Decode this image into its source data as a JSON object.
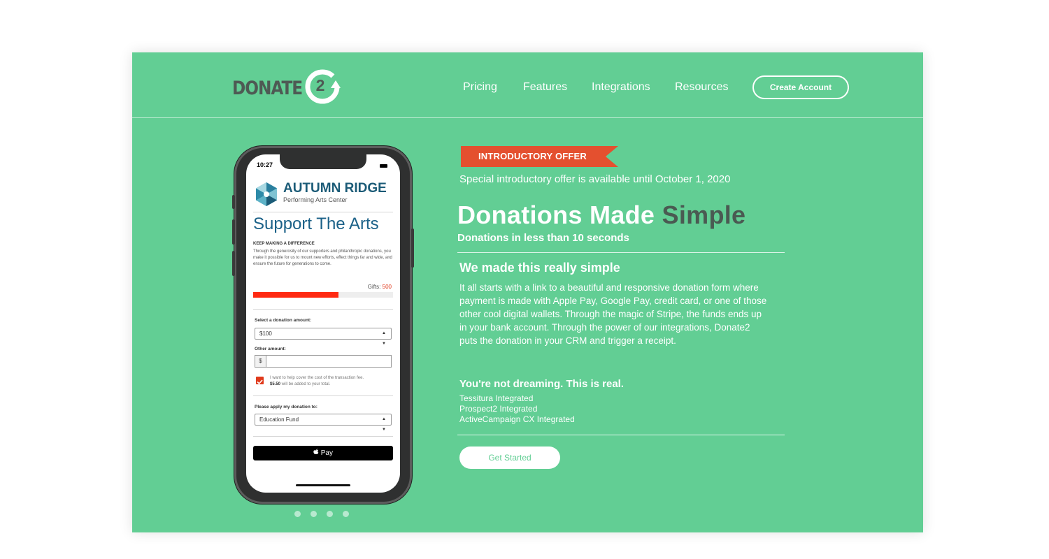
{
  "brand": {
    "logo_text": "DONATE",
    "logo_number": "2",
    "color_green": "#62ce94",
    "color_dark": "#4e5a54",
    "color_ribbon": "#e4502f"
  },
  "nav": {
    "links": [
      "Pricing",
      "Features",
      "Integrations",
      "Resources"
    ],
    "cta_label": "Create  Account"
  },
  "phone": {
    "time": "10:27",
    "org_name": "AUTUMN RIDGE",
    "org_sub": "Performing Arts Center",
    "heading": "Support The Arts",
    "kicker": "KEEP MAKING A DIFFERENCE",
    "body": "Through the generosity of our supporters and philanthropic donations, you make it possible for us to mount new efforts, effect things far and wide, and ensure the future for generations to come.",
    "gifts_label": "Gifts:",
    "gifts_count": "500",
    "progress_fraction": 0.61,
    "amount_label": "Select a donation amount:",
    "amount_value": "$100",
    "other_label": "Other amount:",
    "currency_symbol": "$",
    "fee_text": "I want to help cover the cost of the transaction fee.",
    "fee_amount": "$5.50",
    "fee_suffix": "will be added to your total.",
    "apply_label": "Please apply my donation to:",
    "apply_value": "Education Fund",
    "pay_label": "Pay",
    "pay_icon": "apple-icon"
  },
  "carousel": {
    "dot_count": 4
  },
  "hero": {
    "ribbon": "INTRODUCTORY OFFER",
    "special": "Special introductory offer is available until October 1, 2020",
    "headline_main": "Donations Made ",
    "headline_accent": "Simple",
    "subhead": "Donations in less than 10 seconds",
    "section_title": "We made this really simple",
    "section_body": "It all starts with a link to a beautiful and responsive donation form where payment is made with Apple Pay, Google Pay, credit card, or one of those other cool digital wallets. Through the magic of Stripe, the funds ends up in your bank account. Through the power of our integrations, Donate2 puts the donation in your CRM and trigger a receipt.",
    "real_title": "You're not dreaming. This is real.",
    "integrations": [
      "Tessitura Integrated",
      "Prospect2 Integrated",
      "ActiveCampaign CX Integrated"
    ],
    "cta_label": "Get  Started"
  }
}
